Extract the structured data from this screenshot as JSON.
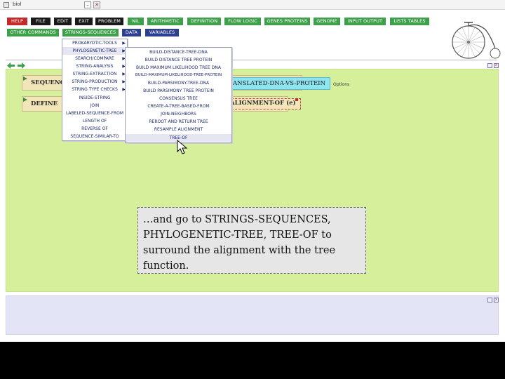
{
  "window": {
    "title": "biol",
    "minimize_glyph": "–",
    "close_glyph": "✕"
  },
  "menubar": {
    "row1": [
      {
        "label": "HELP",
        "color": "red"
      },
      {
        "label": "FILE",
        "color": "black"
      },
      {
        "label": "EDIT",
        "color": "black"
      },
      {
        "label": "EXIT",
        "color": "black"
      },
      {
        "label": "PROBLEM",
        "color": "black"
      },
      {
        "label": "NIL",
        "color": "green"
      },
      {
        "label": "ARITHMETIC",
        "color": "green"
      },
      {
        "label": "DEFINITION",
        "color": "green"
      },
      {
        "label": "FLOW LOGIC",
        "color": "green"
      },
      {
        "label": "GENES PROTEINS",
        "color": "green"
      },
      {
        "label": "GENOME",
        "color": "green"
      },
      {
        "label": "INPUT OUTPUT",
        "color": "green"
      },
      {
        "label": "LISTS TABLES",
        "color": "green"
      }
    ],
    "row2": [
      {
        "label": "OTHER COMMANDS",
        "color": "green"
      },
      {
        "label": "STRINGS-SEQUENCES",
        "color": "green"
      },
      {
        "label": "DATA",
        "color": "navy"
      },
      {
        "label": "VARIABLES",
        "color": "navy"
      }
    ]
  },
  "workspace": {
    "seq_keyword": "SEQUENC",
    "define_keyword": "DEFINE",
    "cyan_text": "ANSLATED-DNA-VS-PROTEIN",
    "options_label": "Options",
    "align_text": "ALIGNMENT-OF (e)",
    "seq_prefix": "N"
  },
  "menu_strings": {
    "items": [
      {
        "label": "PROKARYOTIC-TOOLS",
        "has_sub": true
      },
      {
        "label": "PHYLOGENETIC-TREE",
        "has_sub": true,
        "selected": true
      },
      {
        "label": "SEARCH/COMPARE",
        "has_sub": true
      },
      {
        "label": "STRING-ANALYSIS",
        "has_sub": true
      },
      {
        "label": "STRING-EXTRACTION",
        "has_sub": true
      },
      {
        "label": "STRING-PRODUCTION",
        "has_sub": true
      },
      {
        "label": "STRING TYPE CHECKS",
        "has_sub": true
      },
      {
        "label": "INSIDE-STRING",
        "has_sub": false
      },
      {
        "label": "JOIN",
        "has_sub": false
      },
      {
        "label": "LABELED-SEQUENCE-FROM",
        "has_sub": false
      },
      {
        "label": "LENGTH OF",
        "has_sub": false
      },
      {
        "label": "REVERSE OF",
        "has_sub": false
      },
      {
        "label": "SEQUENCE-SIMILAR-TO",
        "has_sub": false
      }
    ],
    "arrow_glyph": "▶"
  },
  "menu_phylo": {
    "items": [
      {
        "label": "BUILD-DISTANCE-TREE-DNA"
      },
      {
        "label": "BUILD DISTANCE TREE PROTEIN"
      },
      {
        "label": "BUILD MAXIMUM LIKELIHOOD TREE DNA"
      },
      {
        "label": "BUILD-MAXIMUM-LIKELIHOOD-TREE-PROTEIN"
      },
      {
        "label": "BUILD-PARSIMONY-TREE-DNA"
      },
      {
        "label": "BUILD PARSIMONY TREE PROTEIN"
      },
      {
        "label": "CONSENSUS TREE"
      },
      {
        "label": "CREATE-A-TREE-BASED-FROM"
      },
      {
        "label": "JOIN-NEIGHBORS"
      },
      {
        "label": "REROOT AND RETURN TREE"
      },
      {
        "label": "RESAMPLE ALIGNMENT"
      },
      {
        "label": "TREE-OF",
        "selected": true
      }
    ]
  },
  "caption": {
    "text": "…and go to STRINGS-SEQUENCES, PHYLOGENETIC-TREE, TREE-OF to surround the alignment with the tree function."
  },
  "colors": {
    "workspace": "#d6ef9a",
    "bottom_panel": "#e4e4f7",
    "help": "#c52a2a",
    "green_button": "#3fa04b",
    "navy_button": "#2d3f8f",
    "cyan_box": "#8ee5f0",
    "code_box": "#f2e6b8"
  },
  "icons": [
    "app-icon",
    "back-arrow-icon",
    "forward-arrow-icon",
    "bicycle-logo",
    "mouse-cursor-icon",
    "panel-minimize-icon",
    "panel-close-icon"
  ]
}
